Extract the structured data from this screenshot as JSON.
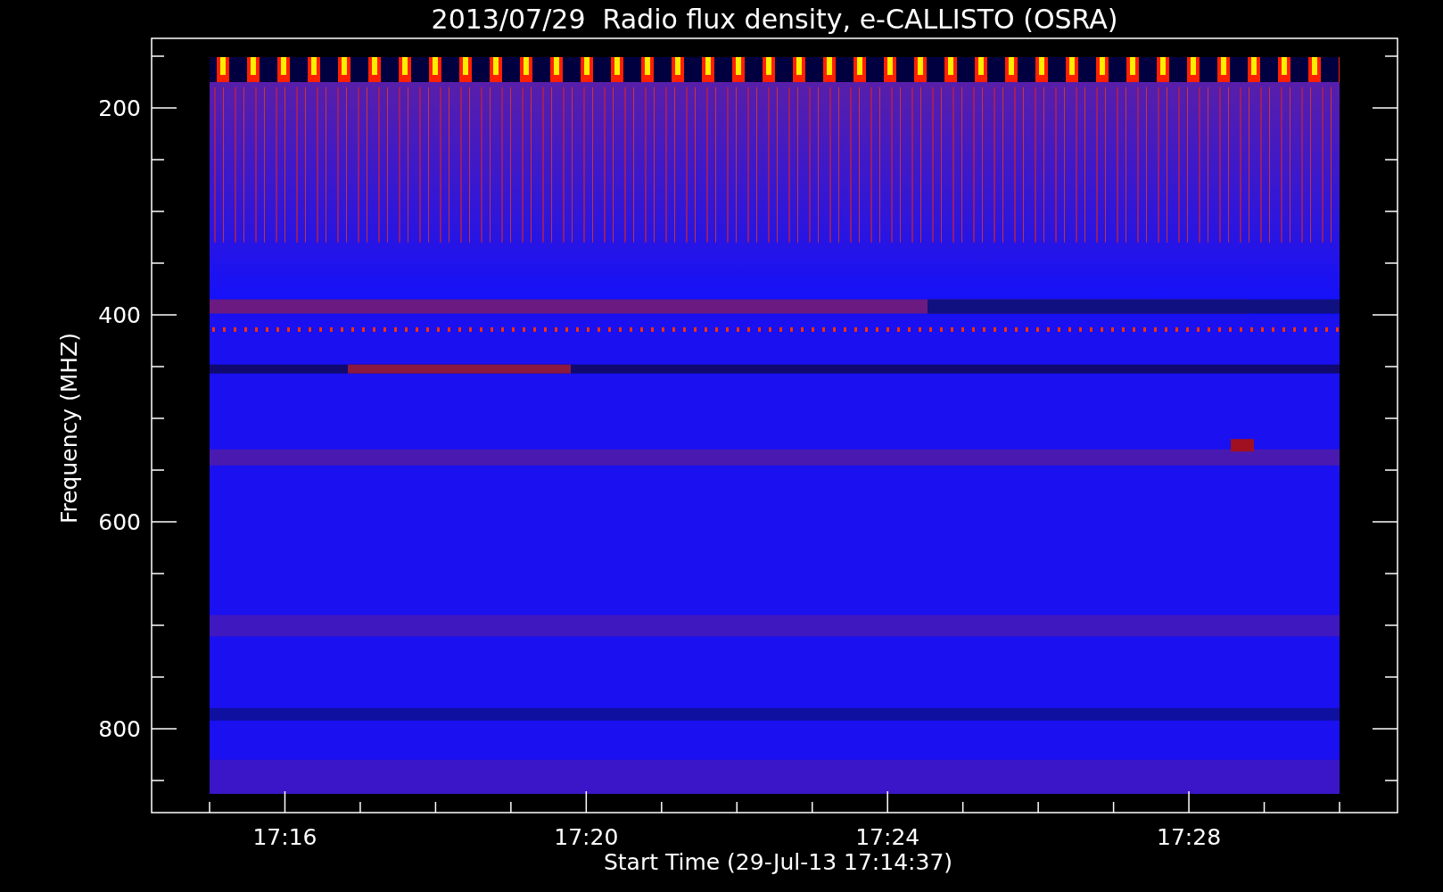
{
  "plot": {
    "title": "2013/07/29  Radio flux density, e-CALLISTO (OSRA)",
    "xlabel": "Start Time (29-Jul-13 17:14:37)",
    "ylabel": "Frequency (MHZ)",
    "xtick_labels": [
      "17:16",
      "17:20",
      "17:24",
      "17:28"
    ],
    "ytick_labels": [
      "200",
      "400",
      "600",
      "800"
    ]
  }
}
